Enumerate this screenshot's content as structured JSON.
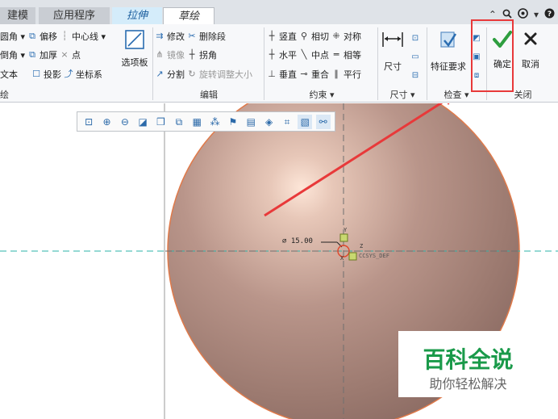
{
  "tabs": [
    {
      "label": "建模"
    },
    {
      "label": "应用程序"
    },
    {
      "label": "拉伸"
    },
    {
      "label": "草绘"
    }
  ],
  "top_icons": [
    "caret-up-icon",
    "search-icon",
    "settings-icon",
    "help-icon"
  ],
  "ribbon": {
    "group1": {
      "rows": [
        {
          "a": "圆角 ▾",
          "b": "偏移",
          "c": "中心线 ▾"
        },
        {
          "a": "倒角 ▾",
          "b": "加厚",
          "c": "点"
        },
        {
          "a": "文本",
          "b": "投影",
          "c": "坐标系"
        }
      ],
      "panel_label": "选项板",
      "group_label": "绘"
    },
    "group2": {
      "rows": [
        {
          "a": "修改",
          "b": "删除段"
        },
        {
          "a": "镜像",
          "b": "拐角"
        },
        {
          "a": "分割",
          "b": "旋转调整大小"
        }
      ],
      "group_label": "编辑"
    },
    "group3": {
      "rows": [
        {
          "a": "竖直",
          "b": "相切",
          "c": "对称"
        },
        {
          "a": "水平",
          "b": "中点",
          "c": "相等"
        },
        {
          "a": "垂直",
          "b": "重合",
          "c": "平行"
        }
      ],
      "group_label": "约束 ▾"
    },
    "group4": {
      "big_label": "尺寸",
      "group_label": "尺寸 ▾"
    },
    "group5": {
      "big_label": "特征要求",
      "group_label": "检查 ▾"
    },
    "group6": {
      "ok_label": "确定",
      "cancel_label": "取消",
      "group_label": "关闭"
    }
  },
  "canvas": {
    "dimension_text": "⌀ 15.00",
    "csys_label": "CCSYS_DEF",
    "axis_labels": [
      "Y",
      "Z",
      "X"
    ]
  },
  "watermark": {
    "title": "百科全说",
    "subtitle": "助你轻松解决"
  },
  "colors": {
    "annotation_red": "#e8393a",
    "ok_green": "#2e9e3f",
    "sphere_mid": "#b0877a",
    "accent_blue": "#2a6cb0",
    "watermark_green": "#1a9a4a"
  }
}
